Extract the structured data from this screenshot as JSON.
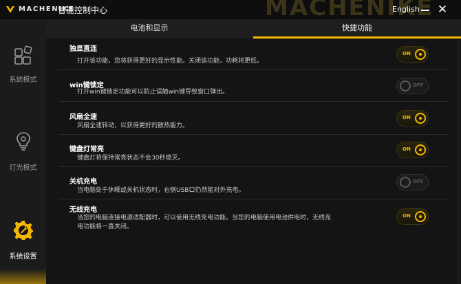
{
  "titlebar": {
    "brand": "MACHENIKE",
    "app_title": "智能控制中心",
    "watermark": "MACHENIKE",
    "language": "English",
    "close_glyph": "✕"
  },
  "sidebar": {
    "items": [
      {
        "label": "系统模式",
        "icon": "windows-grid-icon",
        "active": false
      },
      {
        "label": "灯光模式",
        "icon": "lightbulb-icon",
        "active": false
      },
      {
        "label": "系统设置",
        "icon": "gear-icon",
        "active": true
      }
    ]
  },
  "tabs": [
    {
      "label": "电池和显示",
      "active": false
    },
    {
      "label": "快捷功能",
      "active": true
    }
  ],
  "settings": [
    {
      "title": "独显直连",
      "desc": "打开该功能，您将获得更好的显示性能。关闭该功能，功耗将更低。",
      "state": "ON"
    },
    {
      "title": "win键锁定",
      "desc": "打开win键锁定功能可以防止误触win键导致窗口弹出。",
      "state": "OFF"
    },
    {
      "title": "风扇全速",
      "desc": "风扇全速转动，以获得更好的散热能力。",
      "state": "ON"
    },
    {
      "title": "键盘灯常亮",
      "desc": "键盘灯将保持常亮状态不会30秒熄灭。",
      "state": "ON"
    },
    {
      "title": "关机充电",
      "desc": "当电脑处于休眠或关机状态时，右侧USB口仍然能对外充电。",
      "state": "OFF"
    },
    {
      "title": "无线充电",
      "desc": "当您的电脑连接电源适配器时，可以使用无线充电功能。当您的电脑使用电池供电时，无线充电功能将一直关闭。",
      "state": "ON"
    }
  ],
  "colors": {
    "accent": "#f5b800",
    "background": "#141414",
    "sidebar": "#1b1b1b"
  }
}
